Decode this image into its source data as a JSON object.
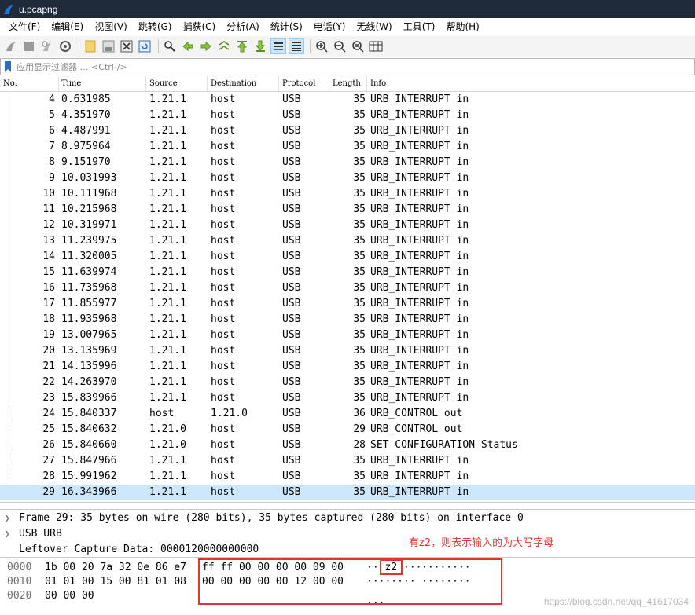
{
  "window": {
    "title": "u.pcapng"
  },
  "menu": [
    "文件(F)",
    "编辑(E)",
    "视图(V)",
    "跳转(G)",
    "捕获(C)",
    "分析(A)",
    "统计(S)",
    "电话(Y)",
    "无线(W)",
    "工具(T)",
    "帮助(H)"
  ],
  "toolbar": {
    "buttons": [
      "shark-fin-start-icon",
      "stop-icon",
      "restart-icon",
      "capture-options-icon",
      "open-file-icon",
      "save-file-icon",
      "close-file-icon",
      "reload-icon",
      "find-icon",
      "go-back-icon",
      "go-forward-icon",
      "go-to-packet-icon",
      "go-first-icon",
      "go-last-icon",
      "autoscroll-icon",
      "colorize-icon",
      "zoom-in-icon",
      "zoom-out-icon",
      "zoom-reset-icon",
      "resize-columns-icon"
    ]
  },
  "filter": {
    "placeholder": "应用显示过滤器 … <Ctrl-/>"
  },
  "columns": [
    "No.",
    "Time",
    "Source",
    "Destination",
    "Protocol",
    "Length",
    "Info"
  ],
  "packets": [
    {
      "no": "4",
      "time": "0.631985",
      "src": "1.21.1",
      "dst": "host",
      "proto": "USB",
      "len": "35",
      "info": "URB_INTERRUPT in"
    },
    {
      "no": "5",
      "time": "4.351970",
      "src": "1.21.1",
      "dst": "host",
      "proto": "USB",
      "len": "35",
      "info": "URB_INTERRUPT in"
    },
    {
      "no": "6",
      "time": "4.487991",
      "src": "1.21.1",
      "dst": "host",
      "proto": "USB",
      "len": "35",
      "info": "URB_INTERRUPT in"
    },
    {
      "no": "7",
      "time": "8.975964",
      "src": "1.21.1",
      "dst": "host",
      "proto": "USB",
      "len": "35",
      "info": "URB_INTERRUPT in"
    },
    {
      "no": "8",
      "time": "9.151970",
      "src": "1.21.1",
      "dst": "host",
      "proto": "USB",
      "len": "35",
      "info": "URB_INTERRUPT in"
    },
    {
      "no": "9",
      "time": "10.031993",
      "src": "1.21.1",
      "dst": "host",
      "proto": "USB",
      "len": "35",
      "info": "URB_INTERRUPT in"
    },
    {
      "no": "10",
      "time": "10.111968",
      "src": "1.21.1",
      "dst": "host",
      "proto": "USB",
      "len": "35",
      "info": "URB_INTERRUPT in"
    },
    {
      "no": "11",
      "time": "10.215968",
      "src": "1.21.1",
      "dst": "host",
      "proto": "USB",
      "len": "35",
      "info": "URB_INTERRUPT in"
    },
    {
      "no": "12",
      "time": "10.319971",
      "src": "1.21.1",
      "dst": "host",
      "proto": "USB",
      "len": "35",
      "info": "URB_INTERRUPT in"
    },
    {
      "no": "13",
      "time": "11.239975",
      "src": "1.21.1",
      "dst": "host",
      "proto": "USB",
      "len": "35",
      "info": "URB_INTERRUPT in"
    },
    {
      "no": "14",
      "time": "11.320005",
      "src": "1.21.1",
      "dst": "host",
      "proto": "USB",
      "len": "35",
      "info": "URB_INTERRUPT in"
    },
    {
      "no": "15",
      "time": "11.639974",
      "src": "1.21.1",
      "dst": "host",
      "proto": "USB",
      "len": "35",
      "info": "URB_INTERRUPT in"
    },
    {
      "no": "16",
      "time": "11.735968",
      "src": "1.21.1",
      "dst": "host",
      "proto": "USB",
      "len": "35",
      "info": "URB_INTERRUPT in"
    },
    {
      "no": "17",
      "time": "11.855977",
      "src": "1.21.1",
      "dst": "host",
      "proto": "USB",
      "len": "35",
      "info": "URB_INTERRUPT in"
    },
    {
      "no": "18",
      "time": "11.935968",
      "src": "1.21.1",
      "dst": "host",
      "proto": "USB",
      "len": "35",
      "info": "URB_INTERRUPT in"
    },
    {
      "no": "19",
      "time": "13.007965",
      "src": "1.21.1",
      "dst": "host",
      "proto": "USB",
      "len": "35",
      "info": "URB_INTERRUPT in"
    },
    {
      "no": "20",
      "time": "13.135969",
      "src": "1.21.1",
      "dst": "host",
      "proto": "USB",
      "len": "35",
      "info": "URB_INTERRUPT in"
    },
    {
      "no": "21",
      "time": "14.135996",
      "src": "1.21.1",
      "dst": "host",
      "proto": "USB",
      "len": "35",
      "info": "URB_INTERRUPT in"
    },
    {
      "no": "22",
      "time": "14.263970",
      "src": "1.21.1",
      "dst": "host",
      "proto": "USB",
      "len": "35",
      "info": "URB_INTERRUPT in"
    },
    {
      "no": "23",
      "time": "15.839966",
      "src": "1.21.1",
      "dst": "host",
      "proto": "USB",
      "len": "35",
      "info": "URB_INTERRUPT in"
    },
    {
      "no": "24",
      "time": "15.840337",
      "src": "host",
      "dst": "1.21.0",
      "proto": "USB",
      "len": "36",
      "info": "URB_CONTROL out"
    },
    {
      "no": "25",
      "time": "15.840632",
      "src": "1.21.0",
      "dst": "host",
      "proto": "USB",
      "len": "29",
      "info": "URB_CONTROL out"
    },
    {
      "no": "26",
      "time": "15.840660",
      "src": "1.21.0",
      "dst": "host",
      "proto": "USB",
      "len": "28",
      "info": "SET CONFIGURATION Status"
    },
    {
      "no": "27",
      "time": "15.847966",
      "src": "1.21.1",
      "dst": "host",
      "proto": "USB",
      "len": "35",
      "info": "URB_INTERRUPT in"
    },
    {
      "no": "28",
      "time": "15.991962",
      "src": "1.21.1",
      "dst": "host",
      "proto": "USB",
      "len": "35",
      "info": "URB_INTERRUPT in"
    },
    {
      "no": "29",
      "time": "16.343966",
      "src": "1.21.1",
      "dst": "host",
      "proto": "USB",
      "len": "35",
      "info": "URB_INTERRUPT in",
      "selected": true
    }
  ],
  "details": [
    {
      "text": "Frame 29: 35 bytes on wire (280 bits), 35 bytes captured (280 bits) on interface 0",
      "expandable": true
    },
    {
      "text": "USB URB",
      "expandable": true
    },
    {
      "text": "Leftover Capture Data: 0000120000000000",
      "expandable": false
    }
  ],
  "annotation": "有z2，则表示输入的为大写字母",
  "bytes": [
    {
      "offset": "0000",
      "hex1": "1b 00 20 7a 32 0e 86 e7",
      "hex2": "ff ff 00 00 00 00 09 00",
      "ascii1": "·· z2 ···",
      "ascii2": " ········"
    },
    {
      "offset": "0010",
      "hex1": "01 01 00 15 00 81 01 08",
      "hex2": "00 00 00 00 00 12 00 00",
      "ascii1": "········",
      "ascii2": " ········"
    },
    {
      "offset": "0020",
      "hex1": "00 00 00",
      "hex2": "",
      "ascii1": "···",
      "ascii2": ""
    }
  ],
  "watermark": "https://blog.csdn.net/qq_41617034",
  "colors": {
    "selection": "#cce8ff",
    "annotation": "#e8322c",
    "titlebar": "#1f2a3a"
  }
}
